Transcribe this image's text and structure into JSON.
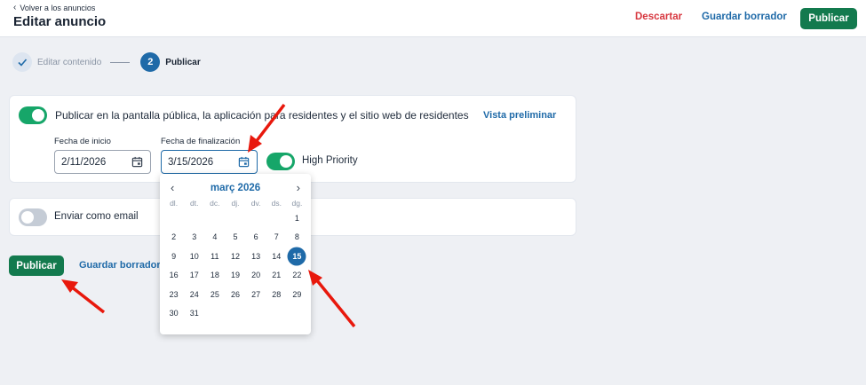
{
  "header": {
    "back_label": "Volver a los anuncios",
    "title": "Editar anuncio",
    "discard_label": "Descartar",
    "save_draft_label": "Guardar borrador",
    "publish_label": "Publicar"
  },
  "stepper": {
    "step1_label": "Editar contenido",
    "step2_number": "2",
    "step2_label": "Publicar"
  },
  "publish_card": {
    "toggle_on": true,
    "toggle_label": "Publicar en la pantalla pública, la aplicación para residentes y el sitio web de residentes",
    "preview_label": "Vista preliminar",
    "start_date_label": "Fecha de inicio",
    "start_date_value": "2/11/2026",
    "end_date_label": "Fecha de finalización",
    "end_date_value": "3/15/2026",
    "high_priority_on": true,
    "high_priority_label": "High Priority"
  },
  "email_card": {
    "toggle_on": false,
    "label": "Enviar como email"
  },
  "datepicker": {
    "month_label": "març 2026",
    "weekdays": [
      "dl.",
      "dt.",
      "dc.",
      "dj.",
      "dv.",
      "ds.",
      "dg."
    ],
    "leading_blanks": 6,
    "days": [
      "1",
      "2",
      "3",
      "4",
      "5",
      "6",
      "7",
      "8",
      "9",
      "10",
      "11",
      "12",
      "13",
      "14",
      "15",
      "16",
      "17",
      "18",
      "19",
      "20",
      "21",
      "22",
      "23",
      "24",
      "25",
      "26",
      "27",
      "28",
      "29",
      "30",
      "31"
    ],
    "selected_day": "15"
  },
  "footer": {
    "publish_label": "Publicar",
    "save_draft_label": "Guardar borrador"
  },
  "colors": {
    "primary_green": "#137a4e",
    "toggle_green": "#16a669",
    "link_blue": "#1f6aa8",
    "discard_red": "#d7373f",
    "annotation_arrow_red": "#e8180c"
  }
}
